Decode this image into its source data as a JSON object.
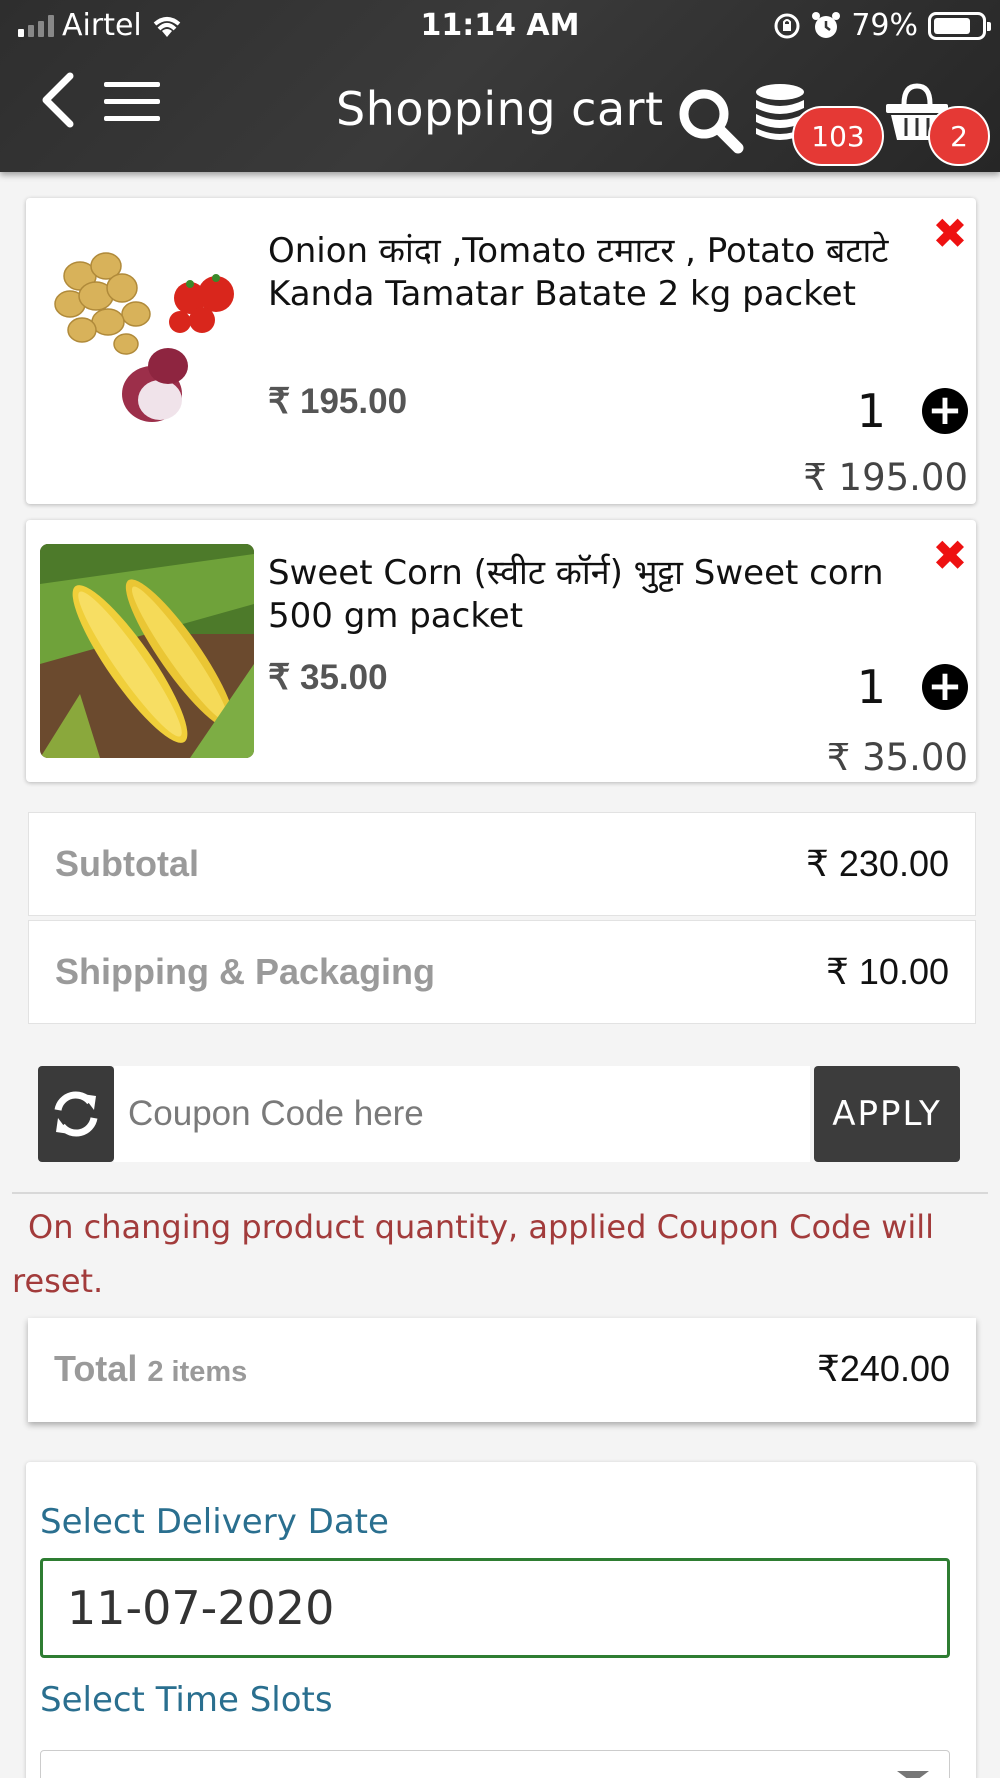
{
  "status_bar": {
    "carrier": "Airtel",
    "time": "11:14 AM",
    "battery": "79%",
    "battery_level": 0.79
  },
  "header": {
    "title": "Shopping cart",
    "wallet_badge": "103",
    "cart_badge": "2",
    "icons": [
      "back-arrow-icon",
      "menu-icon",
      "search-icon",
      "coins-icon",
      "basket-icon"
    ]
  },
  "cart_items": [
    {
      "name": "Onion कांदा ,Tomato टमाटर , Potato बटाटे Kanda Tamatar Batate 2 kg packet",
      "price": "₹ 195.00",
      "quantity": "1",
      "line_total": "₹ 195.00"
    },
    {
      "name": "Sweet Corn (स्वीट कॉर्न) भुट्टा Sweet corn 500 gm packet",
      "price": "₹ 35.00",
      "quantity": "1",
      "line_total": "₹ 35.00"
    }
  ],
  "summary": {
    "subtotal_label": "Subtotal",
    "subtotal_value": "₹ 230.00",
    "shipping_label": "Shipping & Packaging",
    "shipping_value": "₹ 10.00"
  },
  "coupon": {
    "placeholder": "Coupon Code here",
    "apply_label": "APPLY",
    "note": "On changing product quantity, applied Coupon Code will reset."
  },
  "total": {
    "label": "Total",
    "items": "2 items",
    "value": "₹240.00"
  },
  "delivery": {
    "date_label": "Select Delivery Date",
    "date_value": "11-07-2020",
    "time_label": "Select Time Slots"
  },
  "colors": {
    "header_bg": "#2e2e2e",
    "badge": "#e53935",
    "remove": "#ee1111",
    "note": "#a23b3b",
    "delivery_label": "#2a6f8f",
    "date_border": "#2e7d32"
  }
}
